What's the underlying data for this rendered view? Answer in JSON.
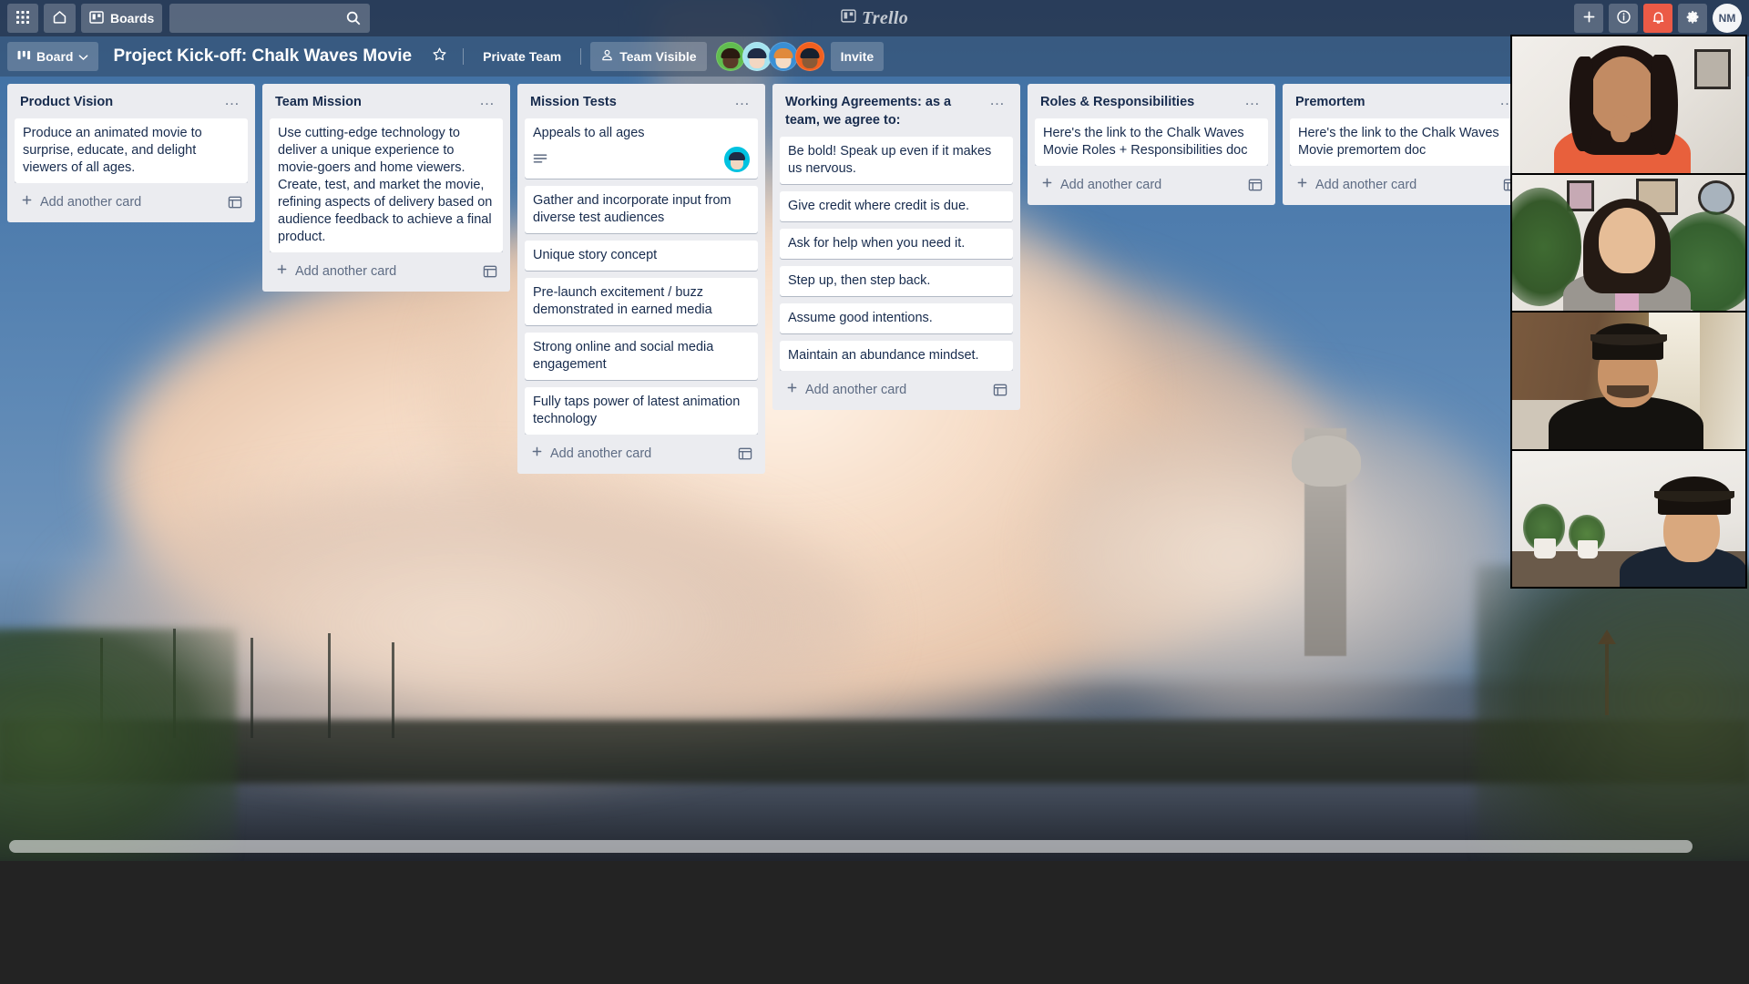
{
  "topnav": {
    "apps_icon": "grid-apps-icon",
    "home_icon": "home-icon",
    "boards_label": "Boards",
    "boards_icon": "board-icon",
    "search_placeholder": "",
    "search_value": "",
    "search_icon": "search-icon",
    "brand": "Trello",
    "brand_icon": "trello-logo-icon",
    "add_icon": "plus-icon",
    "info_icon": "info-circle-icon",
    "notifications_icon": "bell-icon",
    "notifications_active": true,
    "settings_icon": "gear-icon",
    "user_initials": "NM",
    "accent_alert": "#eb5a46"
  },
  "boardbar": {
    "view_label": "Board",
    "view_icon": "board-view-icon",
    "chevron_icon": "chevron-down-icon",
    "title": "Project Kick-off: Chalk Waves Movie",
    "star_icon": "star-icon",
    "visibility_team": "Private Team",
    "visibility_label": "Team Visible",
    "visibility_icon": "person-visible-icon",
    "invite_label": "Invite",
    "members": [
      {
        "name": "member-1",
        "bg": "#61bd4f",
        "skin": "#5a3b28",
        "hair": "#2a1a10"
      },
      {
        "name": "member-2",
        "bg": "#a5e4f0",
        "skin": "#f2d7c2",
        "hair": "#1f2b45"
      },
      {
        "name": "member-3",
        "bg": "#3a8fd4",
        "skin": "#f6dcc4",
        "hair": "#e08a3c"
      },
      {
        "name": "member-4",
        "bg": "#f2601f",
        "skin": "#8a5a36",
        "hair": "#16202e"
      }
    ]
  },
  "lists": [
    {
      "title": "Product Vision",
      "menu_icon": "list-menu-icon",
      "add_card_label": "Add another card",
      "add_card_icon": "plus-icon",
      "template_icon": "card-template-icon",
      "cards": [
        {
          "text": "Produce an animated movie to surprise, educate, and delight viewers of all ages.",
          "has_description": false,
          "avatar": null
        }
      ]
    },
    {
      "title": "Team Mission",
      "menu_icon": "list-menu-icon",
      "add_card_label": "Add another card",
      "add_card_icon": "plus-icon",
      "template_icon": "card-template-icon",
      "cards": [
        {
          "text": "Use cutting-edge technology to deliver a unique experience to movie-goers and home viewers. Create, test, and market the movie, refining aspects of delivery based on audience feedback to achieve a final product.",
          "has_description": false,
          "avatar": null
        }
      ]
    },
    {
      "title": "Mission Tests",
      "menu_icon": "list-menu-icon",
      "add_card_label": "Add another card",
      "add_card_icon": "plus-icon",
      "template_icon": "card-template-icon",
      "cards": [
        {
          "text": "Appeals to all ages",
          "has_description": true,
          "description_icon": "description-badge-icon",
          "avatar": "#00c2e0"
        },
        {
          "text": "Gather and incorporate input from diverse test audiences",
          "has_description": false,
          "avatar": null
        },
        {
          "text": "Unique story concept",
          "has_description": false,
          "avatar": null
        },
        {
          "text": "Pre-launch excitement / buzz demonstrated in earned media",
          "has_description": false,
          "avatar": null
        },
        {
          "text": "Strong online and social media engagement",
          "has_description": false,
          "avatar": null
        },
        {
          "text": "Fully taps power of latest animation technology",
          "has_description": false,
          "avatar": null
        }
      ]
    },
    {
      "title": "Working Agreements: as a team, we agree to:",
      "menu_icon": "list-menu-icon",
      "add_card_label": "Add another card",
      "add_card_icon": "plus-icon",
      "template_icon": "card-template-icon",
      "cards": [
        {
          "text": "Be bold! Speak up even if it makes us nervous.",
          "has_description": false,
          "avatar": null
        },
        {
          "text": "Give credit where credit is due.",
          "has_description": false,
          "avatar": null
        },
        {
          "text": "Ask for help when you need it.",
          "has_description": false,
          "avatar": null
        },
        {
          "text": "Step up, then step back.",
          "has_description": false,
          "avatar": null
        },
        {
          "text": "Assume good intentions.",
          "has_description": false,
          "avatar": null
        },
        {
          "text": "Maintain an abundance mindset.",
          "has_description": false,
          "avatar": null
        }
      ]
    },
    {
      "title": "Roles & Responsibilities",
      "menu_icon": "list-menu-icon",
      "add_card_label": "Add another card",
      "add_card_icon": "plus-icon",
      "template_icon": "card-template-icon",
      "cards": [
        {
          "text": "Here's the link to the Chalk Waves Movie Roles + Responsibilities doc",
          "has_description": false,
          "avatar": null
        }
      ]
    },
    {
      "title": "Premortem",
      "menu_icon": "list-menu-icon",
      "add_card_label": "Add another card",
      "add_card_icon": "plus-icon",
      "template_icon": "card-template-icon",
      "cards": [
        {
          "text": "Here's the link to the Chalk Waves Movie premortem doc",
          "has_description": false,
          "avatar": null
        }
      ]
    }
  ],
  "video_call": {
    "participant_count": 4,
    "participants": [
      {
        "name": "participant-1",
        "wall": "#eceae6",
        "skin": "#c28b63",
        "hair": "#1d1310",
        "shirt": "#e8603c",
        "has_frame": true,
        "has_plant": false,
        "has_cap": false
      },
      {
        "name": "participant-2",
        "wall": "#e9e6e1",
        "skin": "#e6bd97",
        "hair": "#241a14",
        "shirt": "#9a9690",
        "has_frame": true,
        "has_plant": true,
        "has_cap": false
      },
      {
        "name": "participant-3",
        "wall": "#7a5a3e",
        "skin": "#c89368",
        "hair": "#14100d",
        "shirt": "#14120f",
        "has_frame": false,
        "has_plant": false,
        "has_cap": true
      },
      {
        "name": "participant-4",
        "wall": "#edebe7",
        "skin": "#d9a87e",
        "hair": "#17120e",
        "shirt": "#1b2533",
        "has_frame": false,
        "has_plant": true,
        "has_cap": true
      }
    ]
  },
  "scrollbar": {
    "name": "horizontal-scrollbar"
  }
}
